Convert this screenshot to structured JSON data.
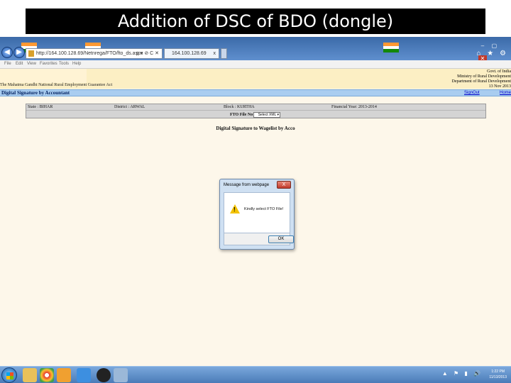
{
  "slide": {
    "title": "Addition of DSC of BDO (dongle)"
  },
  "browser": {
    "address_url": "http://164.100.128.69/Netnrega/FTO/fto_ds.aspx",
    "address_tools": "ρ ▾ ⊘ C ✕",
    "tab_title": "164.100.128.69",
    "tab_close": "x",
    "window_buttons": [
      "–",
      "▢",
      "✕"
    ],
    "chrome_icons": "⌂ ★ ⚙"
  },
  "menu": {
    "items": [
      "File",
      "Edit",
      "View",
      "Favorites",
      "Tools",
      "Help"
    ]
  },
  "header": {
    "govt_lines": [
      "Govt. of India",
      "Ministry of Rural Development",
      "Department of Rural Development"
    ],
    "date": "13 Nov 2013",
    "act_title": "The Mahatma Gandhi National Rural Employment Guarantee Act"
  },
  "titlebar": {
    "title": "Digital Signature by Accountant",
    "signout": "SignOut",
    "home": "Home"
  },
  "info": {
    "state": "State : BIHAR",
    "district": "District : ARWAL",
    "block": "Block : KURTHA",
    "financial_year": "Financial Year: 2013-2014",
    "fto_label": "FTO File No :",
    "fto_select": "Select XML"
  },
  "page_heading": "Digital Signature to Wagelist by Acco",
  "dialog": {
    "title": "Message from webpage",
    "close": "X",
    "message": "Kindly select FTO File!",
    "ok": "OK"
  },
  "taskbar": {
    "tray": "▲ ⚑ ▮ 🔊",
    "time": "1:22 PM",
    "date": "11/13/2013"
  },
  "colors": {
    "accent": "#a9cdf0",
    "page_bg": "#fdf7ea",
    "header_bg": "#fcefc4"
  }
}
